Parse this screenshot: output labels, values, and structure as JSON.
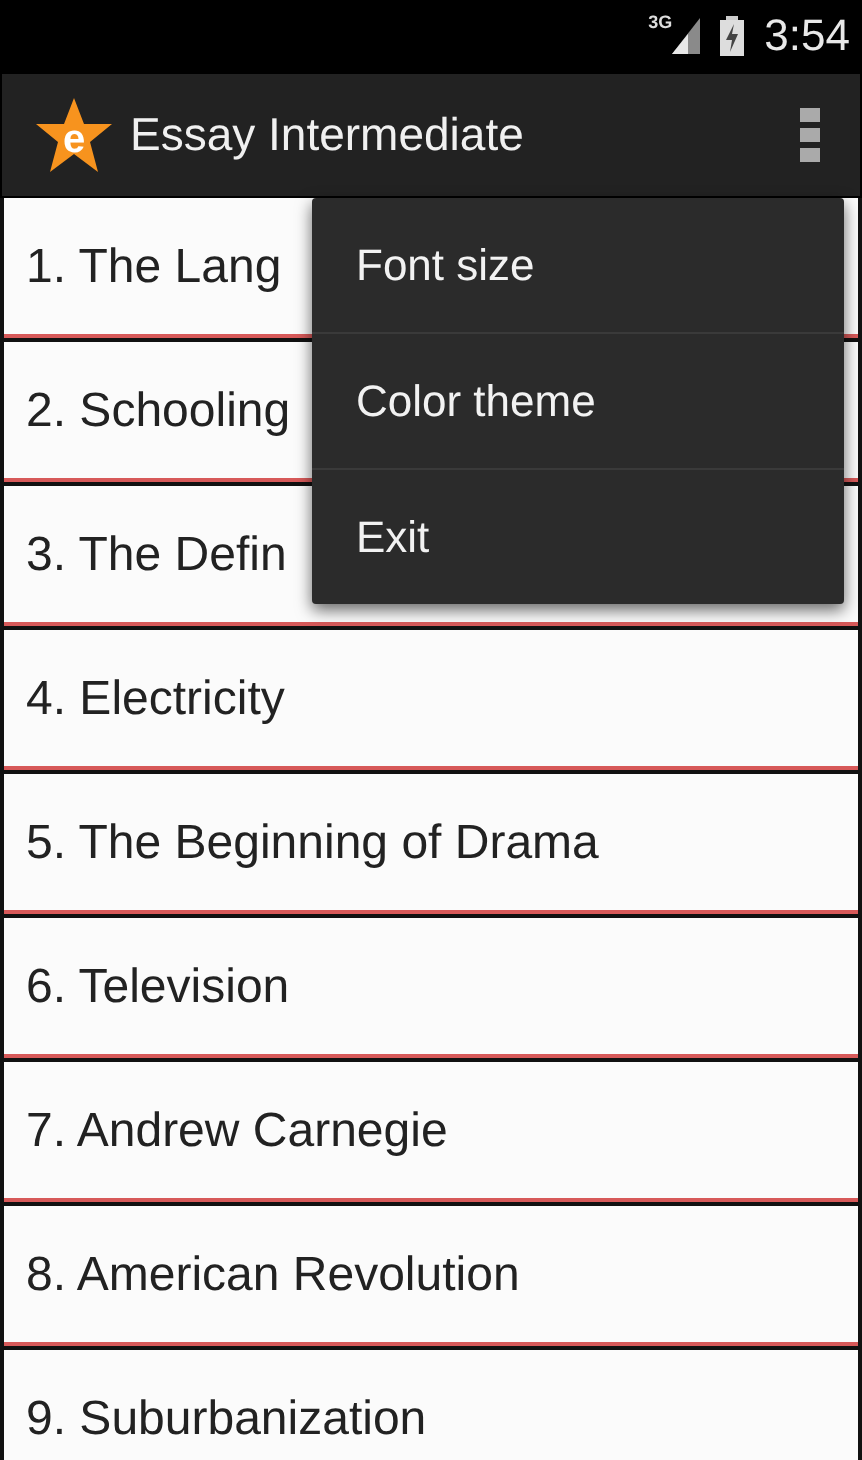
{
  "status_bar": {
    "network": "3G",
    "time": "3:54"
  },
  "app_bar": {
    "logo_letter": "e",
    "title": "Essay Intermediate"
  },
  "list": [
    {
      "label": "1. The Lang"
    },
    {
      "label": "2. Schooling"
    },
    {
      "label": "3. The Defin"
    },
    {
      "label": "4. Electricity"
    },
    {
      "label": "5. The Beginning of Drama"
    },
    {
      "label": "6. Television"
    },
    {
      "label": "7. Andrew Carnegie"
    },
    {
      "label": "8. American Revolution"
    },
    {
      "label": "9. Suburbanization"
    }
  ],
  "menu": [
    {
      "label": "Font size"
    },
    {
      "label": "Color theme"
    },
    {
      "label": "Exit"
    }
  ]
}
